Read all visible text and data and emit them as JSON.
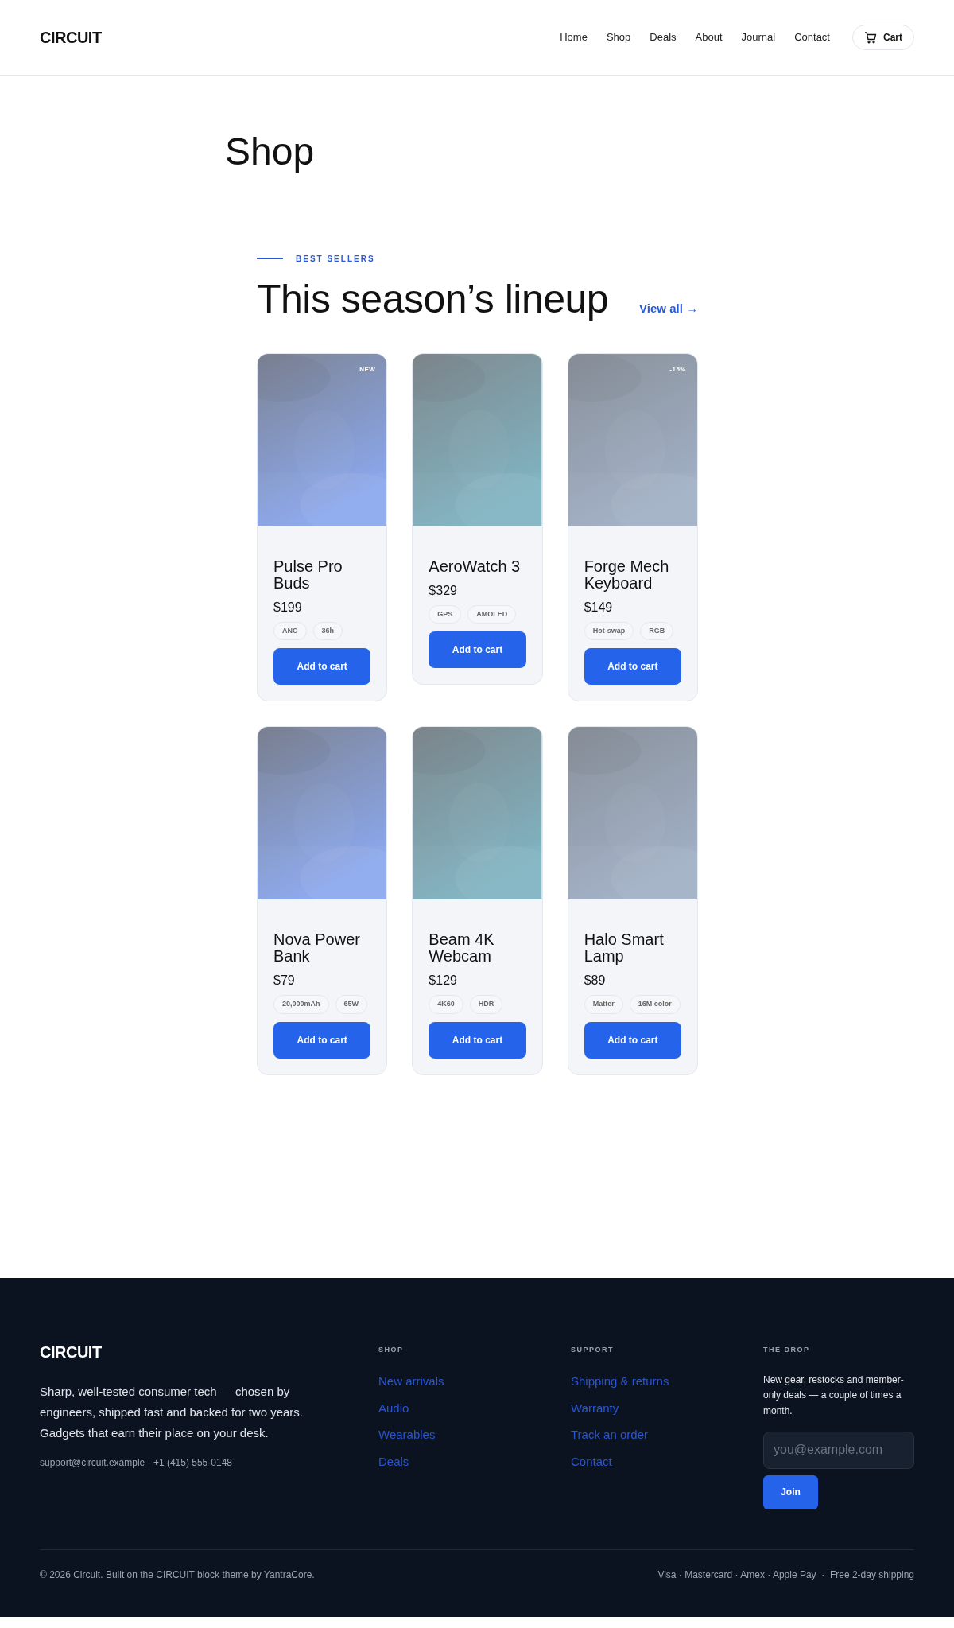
{
  "header": {
    "logo": "CIRCUIT",
    "nav": [
      {
        "label": "Home"
      },
      {
        "label": "Shop"
      },
      {
        "label": "Deals"
      },
      {
        "label": "About"
      },
      {
        "label": "Journal"
      },
      {
        "label": "Contact"
      }
    ],
    "cart": "Cart"
  },
  "page_title": "Shop",
  "section": {
    "eyebrow": "BEST SELLERS",
    "heading": "This season’s lineup",
    "view_all": "View all →"
  },
  "products": [
    {
      "name": "Pulse Pro Buds",
      "price": "$199",
      "badge": "NEW",
      "tags": [
        "ANC",
        "36h"
      ],
      "button": "Add to cart"
    },
    {
      "name": "AeroWatch 3",
      "price": "$329",
      "tags": [
        "GPS",
        "AMOLED"
      ],
      "button": "Add to cart"
    },
    {
      "name": "Forge Mech Keyboard",
      "price": "$149",
      "badge": "-15%",
      "tags": [
        "Hot-swap",
        "RGB"
      ],
      "button": "Add to cart"
    },
    {
      "name": "Nova Power Bank",
      "price": "$79",
      "tags": [
        "20,000mAh",
        "65W"
      ],
      "button": "Add to cart"
    },
    {
      "name": "Beam 4K Webcam",
      "price": "$129",
      "tags": [
        "4K60",
        "HDR"
      ],
      "button": "Add to cart"
    },
    {
      "name": "Halo Smart Lamp",
      "price": "$89",
      "tags": [
        "Matter",
        "16M color"
      ],
      "button": "Add to cart"
    }
  ],
  "footer": {
    "logo": "CIRCUIT",
    "about": "Sharp, well-tested consumer tech — chosen by engineers, shipped fast and backed for two years. Gadgets that earn their place on your desk.",
    "contact": "support@circuit.example · +1 (415) 555-0148",
    "columns": [
      {
        "title": "SHOP",
        "links": [
          "New arrivals",
          "Audio",
          "Wearables",
          "Deals"
        ]
      },
      {
        "title": "SUPPORT",
        "links": [
          "Shipping & returns",
          "Warranty",
          "Track an order",
          "Contact"
        ]
      }
    ],
    "newsletter": {
      "title": "THE DROP",
      "text": "New gear, restocks and member-only deals — a couple of times a month.",
      "placeholder": "you@example.com",
      "button": "Join"
    },
    "copyright": "© 2026 Circuit. Built on the CIRCUIT block theme by YantraCore.",
    "payments": "Visa · Mastercard · Amex · Apple Pay  ·  Free 2-day shipping"
  }
}
